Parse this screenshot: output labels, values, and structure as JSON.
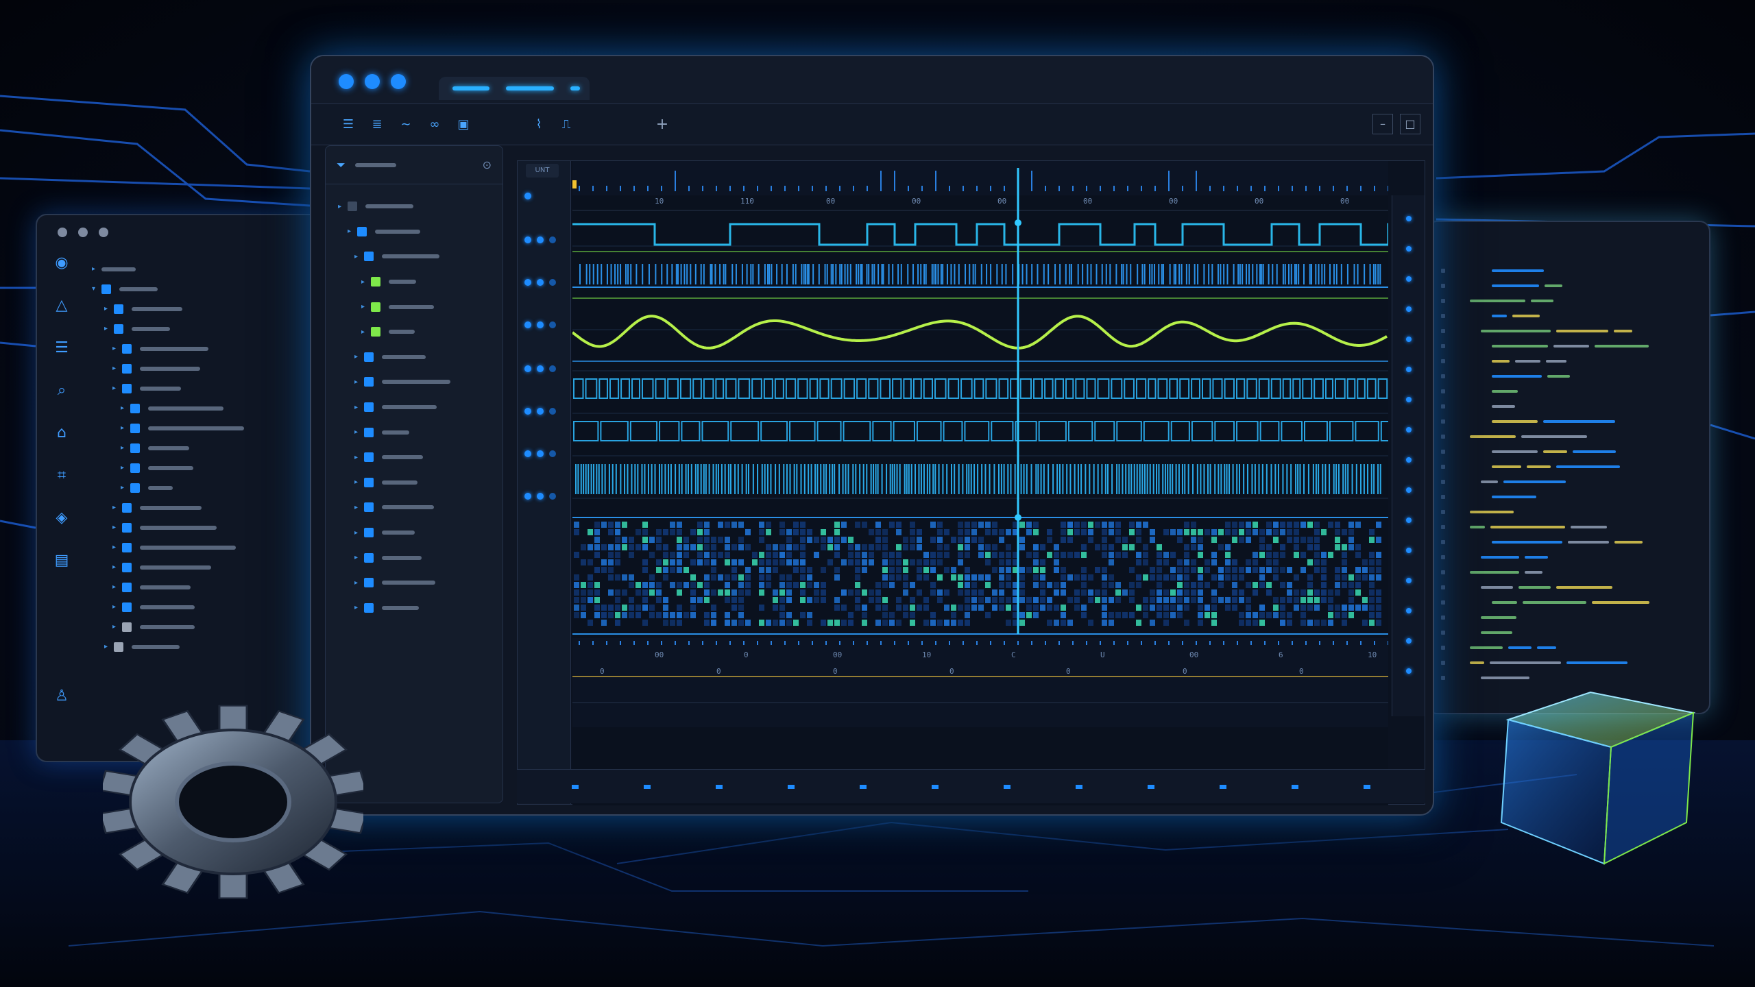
{
  "titlebar": {
    "traffic_lights": [
      "dot-1",
      "dot-2",
      "dot-3"
    ]
  },
  "colors": {
    "accent_blue": "#1e8cff",
    "signal_green": "#b6f04a",
    "signal_cyan": "#29b6e8",
    "cursor_cyan": "#31c8ff",
    "background": "#03060f"
  },
  "icons": {
    "left_rail": [
      "circle-target-icon",
      "triangle-icon",
      "list-icon",
      "search-icon",
      "home-icon",
      "network-icon",
      "diamond-icon",
      "chart-icon",
      "user-icon"
    ],
    "main_toolbar": [
      "menu-icon",
      "layers-icon",
      "wave-icon",
      "link-icon",
      "image-icon",
      "chart-line-icon",
      "chart-step-icon",
      "add-icon"
    ],
    "window_controls": [
      "minimize-icon",
      "maximize-icon"
    ]
  },
  "main": {
    "channel_label": "UNT",
    "add_tab_glyph": "+",
    "minimize_glyph": "–",
    "maximize_glyph": "□"
  },
  "timeline": {
    "top_ticks": [
      "10",
      "110",
      "00",
      "00",
      "00",
      "00",
      "00",
      "00",
      "00"
    ],
    "bottom_ticks": [
      "00",
      "0",
      "00",
      "10",
      "C",
      "U",
      "00",
      "6",
      "10"
    ],
    "lower_ticks": [
      "0",
      "0",
      "0",
      "0",
      "0",
      "0",
      "0"
    ]
  }
}
